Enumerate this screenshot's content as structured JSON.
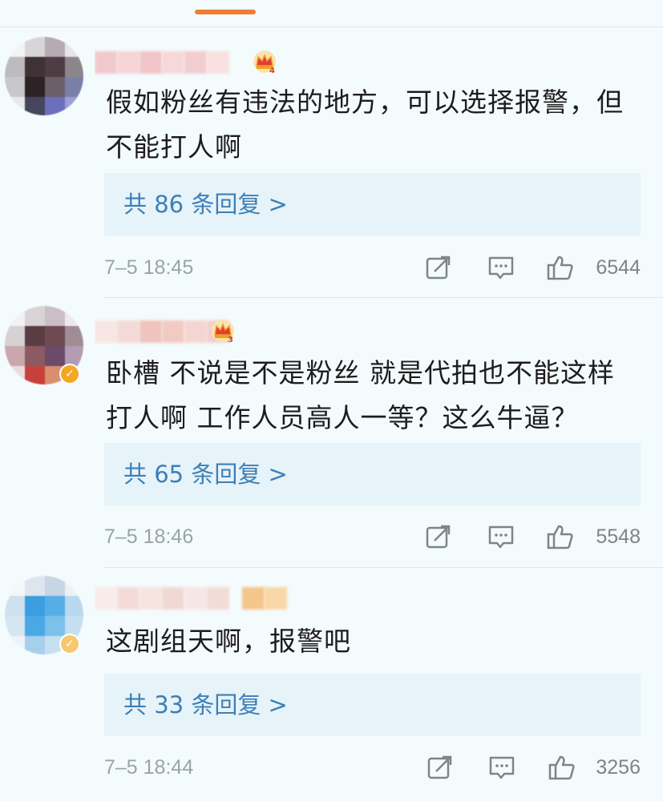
{
  "comments": [
    {
      "text_line1": "假如粉丝有违法的地方，可以选择报警，但",
      "text_line2": "不能打人啊",
      "reply_label": "共 86 条回复 >",
      "timestamp": "7–5 18:45",
      "likes": "6544",
      "badge_level": "4"
    },
    {
      "text_line1": "卧槽 不说是不是粉丝 就是代拍也不能这样",
      "text_line2": "打人啊 工作人员高人一等？这么牛逼？",
      "reply_label": "共 65 条回复 >",
      "timestamp": "7–5 18:46",
      "likes": "5548",
      "badge_level": "3"
    },
    {
      "text_line1": "这剧组天啊，报警吧",
      "text_line2": "",
      "reply_label": "共 33 条回复 >",
      "timestamp": "7–5 18:44",
      "likes": "3256",
      "badge_level": ""
    }
  ],
  "colors": {
    "accent_orange": "#f07b34",
    "link_blue": "#3d7fb7",
    "reply_bg": "#e6f3f9",
    "meta_gray": "#9aa3a6"
  },
  "icons": [
    "crown-badge-icon",
    "verified-icon",
    "repost-icon",
    "comment-icon",
    "thumbs-up-icon"
  ]
}
